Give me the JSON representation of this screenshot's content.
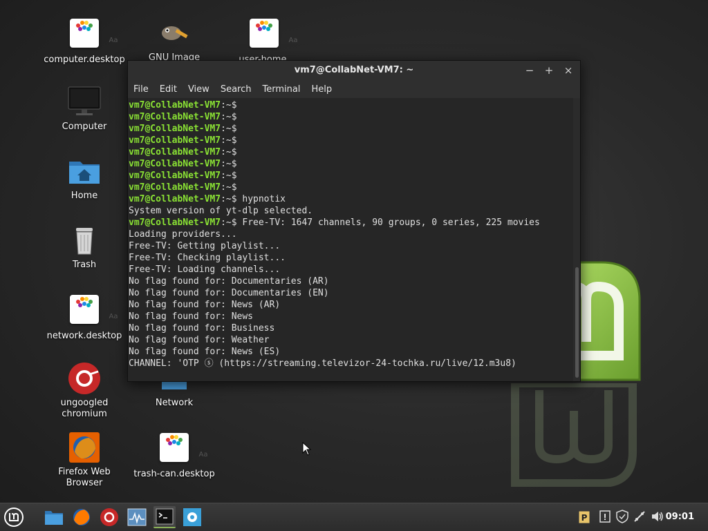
{
  "desktop_icons": {
    "computer_desktop": "computer.desktop",
    "gnu_image": "GNU Image",
    "user_home": "user-home.",
    "computer": "Computer",
    "home": "Home",
    "trash": "Trash",
    "network_desktop": "network.desktop",
    "ungoogled_1": "ungoogled",
    "ungoogled_2": "chromium",
    "network": "Network",
    "firefox_1": "Firefox Web",
    "firefox_2": "Browser",
    "trash_can": "trash-can.desktop",
    "doc_badge": "Aa"
  },
  "terminal": {
    "title": "vm7@CollabNet-VM7: ~",
    "menu": [
      "File",
      "Edit",
      "View",
      "Search",
      "Terminal",
      "Help"
    ],
    "prompt": "vm7@CollabNet-VM7",
    "prompt_suffix": ":~$",
    "lines": [
      {
        "p": true,
        "t": ""
      },
      {
        "p": true,
        "t": ""
      },
      {
        "p": true,
        "t": ""
      },
      {
        "p": true,
        "t": ""
      },
      {
        "p": true,
        "t": ""
      },
      {
        "p": true,
        "t": ""
      },
      {
        "p": true,
        "t": ""
      },
      {
        "p": true,
        "t": ""
      },
      {
        "p": true,
        "t": " hypnotix"
      },
      {
        "p": false,
        "t": "System version of yt-dlp selected."
      },
      {
        "p": true,
        "t": " Free-TV: 1647 channels, 90 groups, 0 series, 225 movies"
      },
      {
        "p": false,
        "t": "Loading providers..."
      },
      {
        "p": false,
        "t": "Free-TV: Getting playlist..."
      },
      {
        "p": false,
        "t": "Free-TV: Checking playlist..."
      },
      {
        "p": false,
        "t": "Free-TV: Loading channels..."
      },
      {
        "p": false,
        "t": "No flag found for: Documentaries (AR)"
      },
      {
        "p": false,
        "t": "No flag found for: Documentaries (EN)"
      },
      {
        "p": false,
        "t": "No flag found for: News (AR)"
      },
      {
        "p": false,
        "t": "No flag found for: News"
      },
      {
        "p": false,
        "t": "No flag found for: Business"
      },
      {
        "p": false,
        "t": "No flag found for: Weather"
      },
      {
        "p": false,
        "t": "No flag found for: News (ES)"
      },
      {
        "p": false,
        "t": "CHANNEL: 'OTP ⓢ (https://streaming.televizor-24-tochka.ru/live/12.m3u8)"
      }
    ],
    "buttons": {
      "minimize": "−",
      "maximize": "+",
      "close": "×"
    }
  },
  "taskbar": {
    "clock": "09:01"
  },
  "colors": {
    "prompt_green": "#8ae234",
    "mint_green": "#8bc34a",
    "folder_blue": "#3d8fd1"
  }
}
